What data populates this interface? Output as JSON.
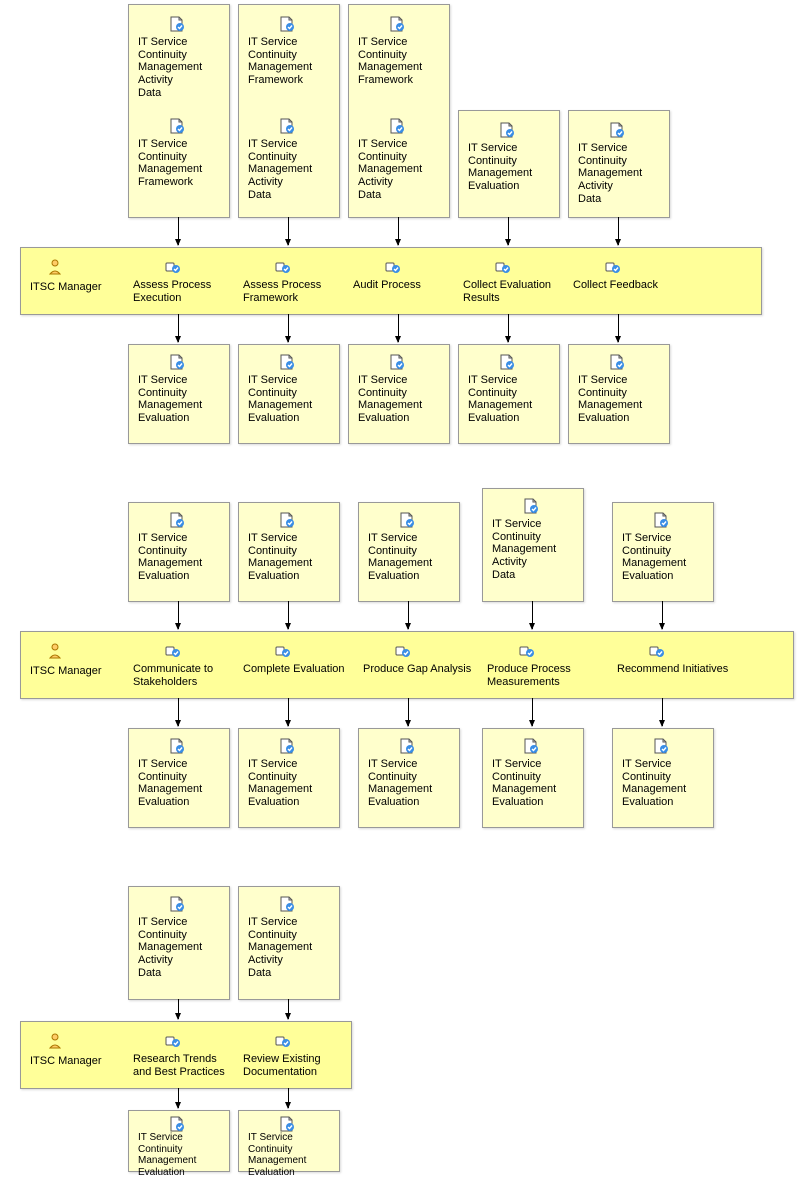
{
  "t": {
    "ad": "IT Service\nContinuity\nManagement\nActivity\nData",
    "fw": "IT Service\nContinuity\nManagement\nFramework",
    "ev": "IT Service\nContinuity\nManagement\nEvaluation",
    "mgr": "ITSC Manager",
    "r1": [
      "Assess Process\nExecution",
      "Assess Process\nFramework",
      "Audit Process",
      "Collect Evaluation\nResults",
      "Collect Feedback"
    ],
    "r2": [
      "Communicate to\nStakeholders",
      "Complete Evaluation",
      "Produce Gap Analysis",
      "Produce Process\nMeasurements",
      "Recommend Initiatives"
    ],
    "r3": [
      "Research Trends\nand Best Practices",
      "Review Existing\nDocumentation"
    ]
  }
}
